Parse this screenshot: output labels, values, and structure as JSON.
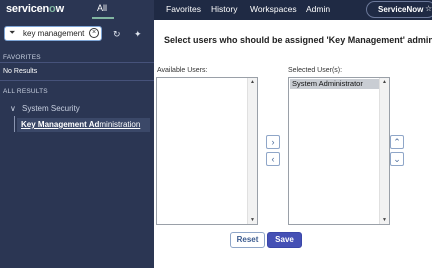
{
  "header": {
    "logo_text": "servicenow",
    "all_label": "All",
    "menu": [
      "Favorites",
      "History",
      "Workspaces",
      "Admin"
    ],
    "instance_label": "ServiceNow",
    "star_icon": "star-icon"
  },
  "sidebar": {
    "filter_value": "key management",
    "filter_icon": "filter-icon",
    "clear_icon": "clear-icon",
    "refresh_icon": "refresh-icon",
    "pin_icon": "pin-icon",
    "favorites_heading": "FAVORITES",
    "no_results": "No Results",
    "all_results_heading": "ALL RESULTS",
    "tree": {
      "parent": "System Security",
      "child_bold": "Key Management Ad",
      "child_rest": "ministration"
    }
  },
  "main": {
    "title": "Select users who should be assigned 'Key Management' admin role",
    "available_label": "Available Users:",
    "selected_label": "Selected User(s):",
    "available_users": [],
    "selected_users": [
      "System Administrator"
    ],
    "reset_label": "Reset",
    "save_label": "Save"
  },
  "colors": {
    "header_bg": "#1f2a44",
    "sidebar_bg": "#2b3653",
    "accent": "#81b5a1",
    "save_bg": "#4550b5"
  }
}
